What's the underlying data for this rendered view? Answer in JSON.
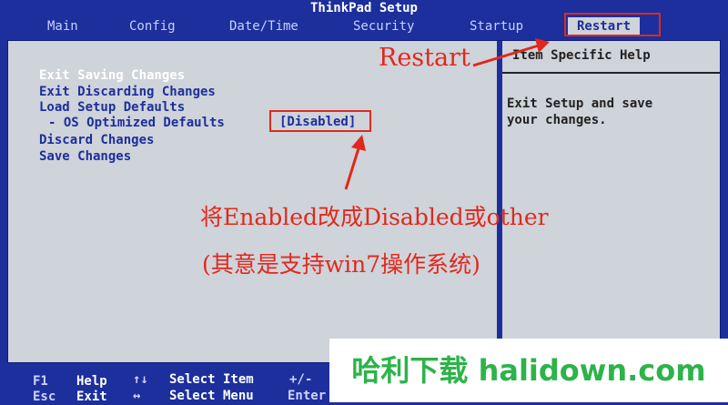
{
  "title": "ThinkPad Setup",
  "tabs": [
    "Main",
    "Config",
    "Date/Time",
    "Security",
    "Startup",
    "Restart"
  ],
  "active_tab": "Restart",
  "items": {
    "exit_saving": "Exit Saving Changes",
    "exit_discarding": "Exit Discarding Changes",
    "load_defaults": "Load Setup Defaults",
    "os_optimized": "- OS Optimized Defaults",
    "os_optimized_value": "[Disabled]",
    "discard": "Discard Changes",
    "save": "Save Changes"
  },
  "help": {
    "heading": "Item Specific Help",
    "text": "Exit Setup and save\nyour changes."
  },
  "footer": {
    "row1": [
      {
        "key": "F1",
        "label": "Help"
      },
      {
        "key": "↑↓",
        "label": "Select Item"
      },
      {
        "key": "+/-",
        "label": ""
      }
    ],
    "row2": [
      {
        "key": "Esc",
        "label": "Exit"
      },
      {
        "key": "↔",
        "label": "Select Menu"
      },
      {
        "key": "Enter",
        "label": ""
      }
    ]
  },
  "annotations": {
    "restart_label": "Restart",
    "instruction_line1": "将Enabled改成Disabled或other",
    "instruction_line2": "(其意是支持win7操作系统)",
    "color": "#e0291c"
  },
  "watermark": "哈利下载 halidown.com",
  "colors": {
    "bios_blue": "#1c2f9c",
    "panel_gray": "#cfd3da",
    "watermark_green": "#2db34a"
  }
}
